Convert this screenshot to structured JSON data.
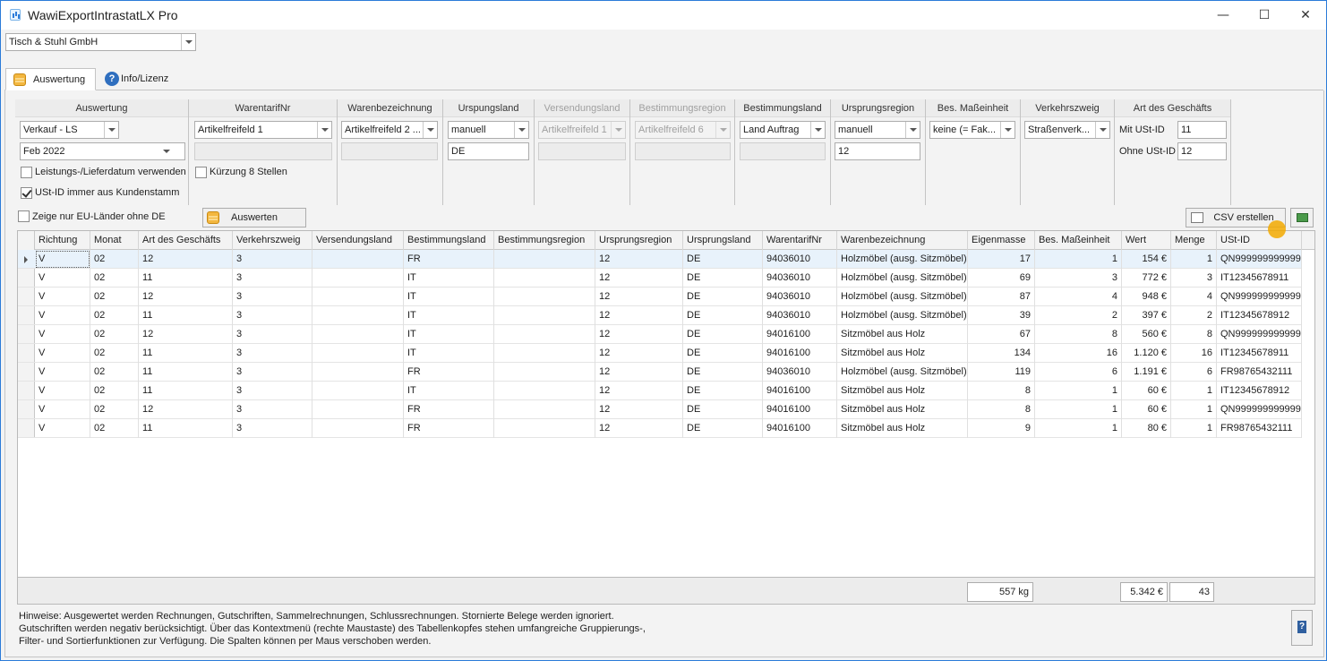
{
  "window": {
    "title": "WawiExportIntrastatLX Pro",
    "minimize": "—",
    "maximize": "☐",
    "close": "✕"
  },
  "company": {
    "value": "Tisch & Stuhl GmbH"
  },
  "tabs": [
    {
      "label": "Auswertung"
    },
    {
      "label": "Info/Lizenz"
    }
  ],
  "filters": {
    "auswertung": {
      "header": "Auswertung",
      "type": "Verkauf - LS",
      "period": "Feb 2022",
      "cb1": "Leistungs-/Lieferdatum verwenden",
      "cb2": "USt-ID immer aus Kundenstamm"
    },
    "warentarif": {
      "header": "WarentarifNr",
      "value": "Artikelfreifeld 1",
      "cb": "Kürzung 8 Stellen"
    },
    "warenbez": {
      "header": "Warenbezeichnung",
      "value": "Artikelfreifeld 2 ..."
    },
    "ursprungsland": {
      "header": "Urspungsland",
      "value": "manuell",
      "text": "DE"
    },
    "versendungsland": {
      "header": "Versendungsland",
      "value": "Artikelfreifeld 1"
    },
    "bestimmungsregion": {
      "header": "Bestimmungsregion",
      "value": "Artikelfreifeld 6"
    },
    "bestimmungsland": {
      "header": "Bestimmungsland",
      "value": "Land Auftrag"
    },
    "ursprungsregion": {
      "header": "Ursprungsregion",
      "value": "manuell",
      "text": "12"
    },
    "masseinheit": {
      "header": "Bes. Maßeinheit",
      "value": "keine (= Fak..."
    },
    "verkehrszweig": {
      "header": "Verkehrszweig",
      "value": "Straßenverk..."
    },
    "geschaeft": {
      "header": "Art des Geschäfts",
      "mit_label": "Mit USt-ID",
      "mit_value": "11",
      "ohne_label": "Ohne USt-ID",
      "ohne_value": "12"
    }
  },
  "eu_only": "Zeige nur EU-Länder ohne DE",
  "buttons": {
    "auswerten": "Auswerten",
    "csv": "CSV erstellen"
  },
  "table": {
    "columns": [
      "Richtung",
      "Monat",
      "Art des Geschäfts",
      "Verkehrszweig",
      "Versendungsland",
      "Bestimmungsland",
      "Bestimmungsregion",
      "Ursprungsregion",
      "Ursprungsland",
      "WarentarifNr",
      "Warenbezeichnung",
      "Eigenmasse",
      "Bes. Maßeinheit",
      "Wert",
      "Menge",
      "USt-ID"
    ],
    "rows": [
      [
        "V",
        "02",
        "12",
        "3",
        "",
        "FR",
        "",
        "12",
        "DE",
        "94036010",
        "Holzmöbel (ausg. Sitzmöbel)",
        "17",
        "1",
        "154 €",
        "1",
        "QN999999999999"
      ],
      [
        "V",
        "02",
        "11",
        "3",
        "",
        "IT",
        "",
        "12",
        "DE",
        "94036010",
        "Holzmöbel (ausg. Sitzmöbel)",
        "69",
        "3",
        "772 €",
        "3",
        "IT12345678911"
      ],
      [
        "V",
        "02",
        "12",
        "3",
        "",
        "IT",
        "",
        "12",
        "DE",
        "94036010",
        "Holzmöbel (ausg. Sitzmöbel)",
        "87",
        "4",
        "948 €",
        "4",
        "QN999999999999"
      ],
      [
        "V",
        "02",
        "11",
        "3",
        "",
        "IT",
        "",
        "12",
        "DE",
        "94036010",
        "Holzmöbel (ausg. Sitzmöbel)",
        "39",
        "2",
        "397 €",
        "2",
        "IT12345678912"
      ],
      [
        "V",
        "02",
        "12",
        "3",
        "",
        "IT",
        "",
        "12",
        "DE",
        "94016100",
        "Sitzmöbel aus Holz",
        "67",
        "8",
        "560 €",
        "8",
        "QN999999999999"
      ],
      [
        "V",
        "02",
        "11",
        "3",
        "",
        "IT",
        "",
        "12",
        "DE",
        "94016100",
        "Sitzmöbel aus Holz",
        "134",
        "16",
        "1.120 €",
        "16",
        "IT12345678911"
      ],
      [
        "V",
        "02",
        "11",
        "3",
        "",
        "FR",
        "",
        "12",
        "DE",
        "94036010",
        "Holzmöbel (ausg. Sitzmöbel)",
        "119",
        "6",
        "1.191 €",
        "6",
        "FR98765432111"
      ],
      [
        "V",
        "02",
        "11",
        "3",
        "",
        "IT",
        "",
        "12",
        "DE",
        "94016100",
        "Sitzmöbel aus Holz",
        "8",
        "1",
        "60 €",
        "1",
        "IT12345678912"
      ],
      [
        "V",
        "02",
        "12",
        "3",
        "",
        "FR",
        "",
        "12",
        "DE",
        "94016100",
        "Sitzmöbel aus Holz",
        "8",
        "1",
        "60 €",
        "1",
        "QN999999999999"
      ],
      [
        "V",
        "02",
        "11",
        "3",
        "",
        "FR",
        "",
        "12",
        "DE",
        "94016100",
        "Sitzmöbel aus Holz",
        "9",
        "1",
        "80 €",
        "1",
        "FR98765432111"
      ]
    ]
  },
  "totals": {
    "eigenmasse": "557 kg",
    "wert": "5.342 €",
    "menge": "43"
  },
  "hint": "Hinweise: Ausgewertet werden Rechnungen, Gutschriften, Sammelrechnungen, Schlussrechnungen. Stornierte Belege werden ignoriert. Gutschriften werden negativ berücksichtigt. Über das Kontextmenü (rechte Maustaste) des Tabellenkopfes stehen umfangreiche Gruppierungs-, Filter- und Sortierfunktionen zur Verfügung. Die Spalten können per Maus verschoben werden."
}
